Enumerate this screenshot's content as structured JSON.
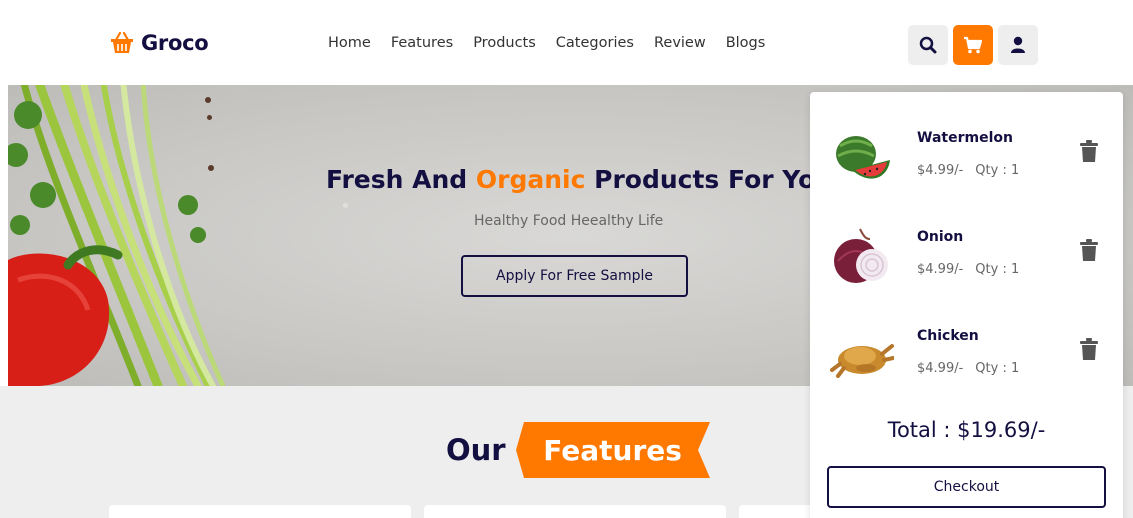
{
  "header": {
    "logo_text": "Groco",
    "nav": [
      "Home",
      "Features",
      "Products",
      "Categories",
      "Review",
      "Blogs"
    ],
    "icons": [
      "search-icon",
      "cart-icon",
      "user-icon"
    ],
    "accent": "#ff7800"
  },
  "hero": {
    "title_part1": "Fresh And ",
    "title_accent": "Organic",
    "title_part2": " Products For You",
    "subtitle": "Healthy Food Heealthy Life",
    "button_label": "Apply For Free Sample"
  },
  "features": {
    "heading_our": "Our",
    "heading_tag": "Features"
  },
  "cart": {
    "items": [
      {
        "name": "Watermelon",
        "price": "$4.99/-",
        "qty": "Qty : 1"
      },
      {
        "name": "Onion",
        "price": "$4.99/-",
        "qty": "Qty : 1"
      },
      {
        "name": "Chicken",
        "price": "$4.99/-",
        "qty": "Qty : 1"
      }
    ],
    "total": "Total : $19.69/-",
    "checkout_label": "Checkout"
  },
  "colors": {
    "primary": "#130f40",
    "accent": "#ff7800",
    "light_bg": "#eeeeee"
  }
}
